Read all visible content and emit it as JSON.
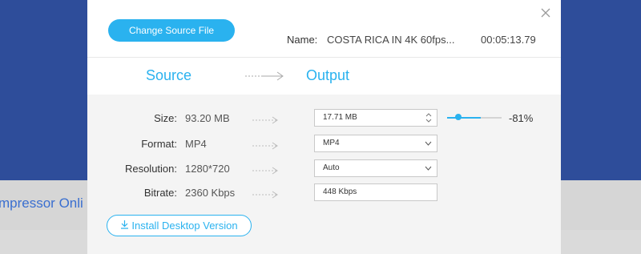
{
  "background": {
    "title_fragment": "mpressor Onli"
  },
  "header": {
    "change_source_label": "Change Source File",
    "name_label": "Name:",
    "file_name": "COSTA RICA IN 4K 60fps...",
    "duration": "00:05:13.79"
  },
  "tabs": {
    "source": "Source",
    "output": "Output"
  },
  "rows": [
    {
      "label": "Size:",
      "source_value": "93.20 MB",
      "output_value": "17.71 MB",
      "control": "stepper"
    },
    {
      "label": "Format:",
      "source_value": "MP4",
      "output_value": "MP4",
      "control": "select"
    },
    {
      "label": "Resolution:",
      "source_value": "1280*720",
      "output_value": "Auto",
      "control": "select"
    },
    {
      "label": "Bitrate:",
      "source_value": "2360 Kbps",
      "output_value": "448 Kbps",
      "control": "readonly"
    }
  ],
  "compression": {
    "percent_label": "-81%",
    "slider_fraction": 0.19
  },
  "install_label": "Install Desktop Version",
  "colors": {
    "accent": "#2ab2ef",
    "banner": "#2e4d9a",
    "panel": "#f4f4f4"
  }
}
